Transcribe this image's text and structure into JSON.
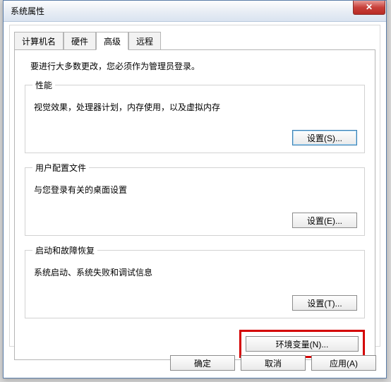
{
  "window": {
    "title": "系统属性"
  },
  "tabs": {
    "items": [
      {
        "label": "计算机名"
      },
      {
        "label": "硬件"
      },
      {
        "label": "高级"
      },
      {
        "label": "远程"
      }
    ],
    "active_index": 2
  },
  "advanced": {
    "note": "要进行大多数更改，您必须作为管理员登录。",
    "performance": {
      "legend": "性能",
      "desc": "视觉效果，处理器计划，内存使用，以及虚拟内存",
      "button": "设置(S)..."
    },
    "profiles": {
      "legend": "用户配置文件",
      "desc": "与您登录有关的桌面设置",
      "button": "设置(E)..."
    },
    "startup": {
      "legend": "启动和故障恢复",
      "desc": "系统启动、系统失败和调试信息",
      "button": "设置(T)..."
    },
    "env_button": "环境变量(N)..."
  },
  "footer": {
    "ok": "确定",
    "cancel": "取消",
    "apply": "应用(A)"
  }
}
